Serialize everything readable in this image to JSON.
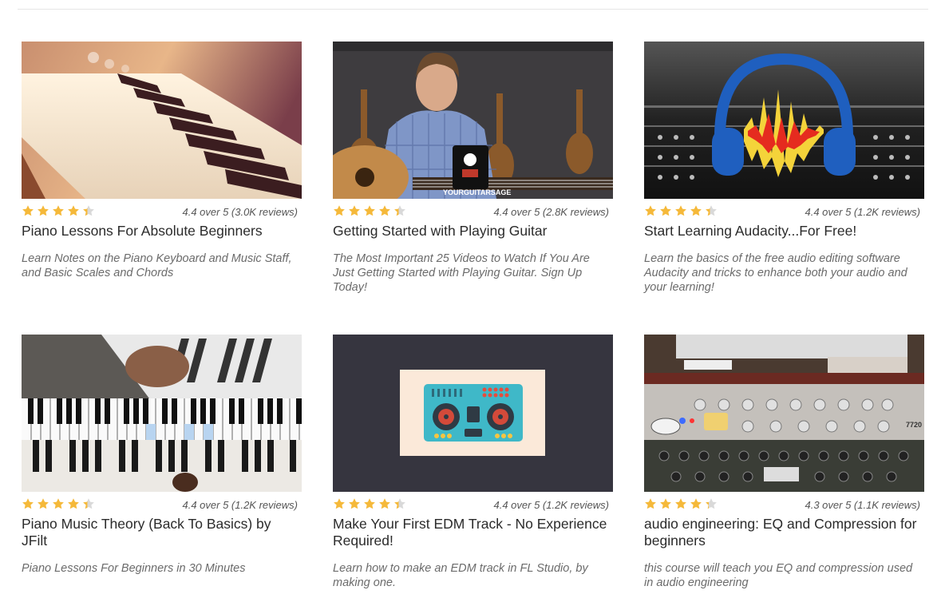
{
  "courses": [
    {
      "thumb": "piano-keys-photo",
      "rating": 4.4,
      "rating_text": "4.4 over 5 (3.0K reviews)",
      "title": "Piano Lessons For Absolute Beginners",
      "desc": "Learn Notes on the Piano Keyboard and Music Staff, and Basic Scales and Chords"
    },
    {
      "thumb": "guitar-instructor-photo",
      "rating": 4.4,
      "rating_text": "4.4 over 5 (2.8K reviews)",
      "title": "Getting Started with Playing Guitar",
      "desc": "The Most Important 25 Videos to Watch If You Are Just Getting Started with Playing Guitar. Sign Up Today!",
      "brand": "YOURGUITARSAGE"
    },
    {
      "thumb": "audacity-headphones-logo",
      "rating": 4.4,
      "rating_text": "4.4 over 5 (1.2K reviews)",
      "title": "Start Learning Audacity...For Free!",
      "desc": "Learn the basics of the free audio editing software Audacity and tricks to enhance both your audio and your learning!"
    },
    {
      "thumb": "piano-theory-overlay",
      "rating": 4.4,
      "rating_text": "4.4 over 5 (1.2K reviews)",
      "title": "Piano Music Theory (Back To Basics) by JFilt",
      "desc": "Piano Lessons For Beginners in 30 Minutes"
    },
    {
      "thumb": "dj-controller-illustration",
      "rating": 4.4,
      "rating_text": "4.4 over 5 (1.2K reviews)",
      "title": "Make Your First EDM Track - No Experience Required!",
      "desc": "Learn how to make an EDM track in FL Studio, by making one."
    },
    {
      "thumb": "audio-rack-photo",
      "rating": 4.3,
      "rating_text": "4.3 over 5 (1.1K reviews)",
      "title": "audio engineering: EQ and Compression for beginners",
      "desc": "this course will teach you EQ and compression used in audio engineering",
      "rack_label": "7720"
    }
  ],
  "colors": {
    "star_filled": "#f5b93a",
    "star_empty": "#d9d9d9"
  }
}
